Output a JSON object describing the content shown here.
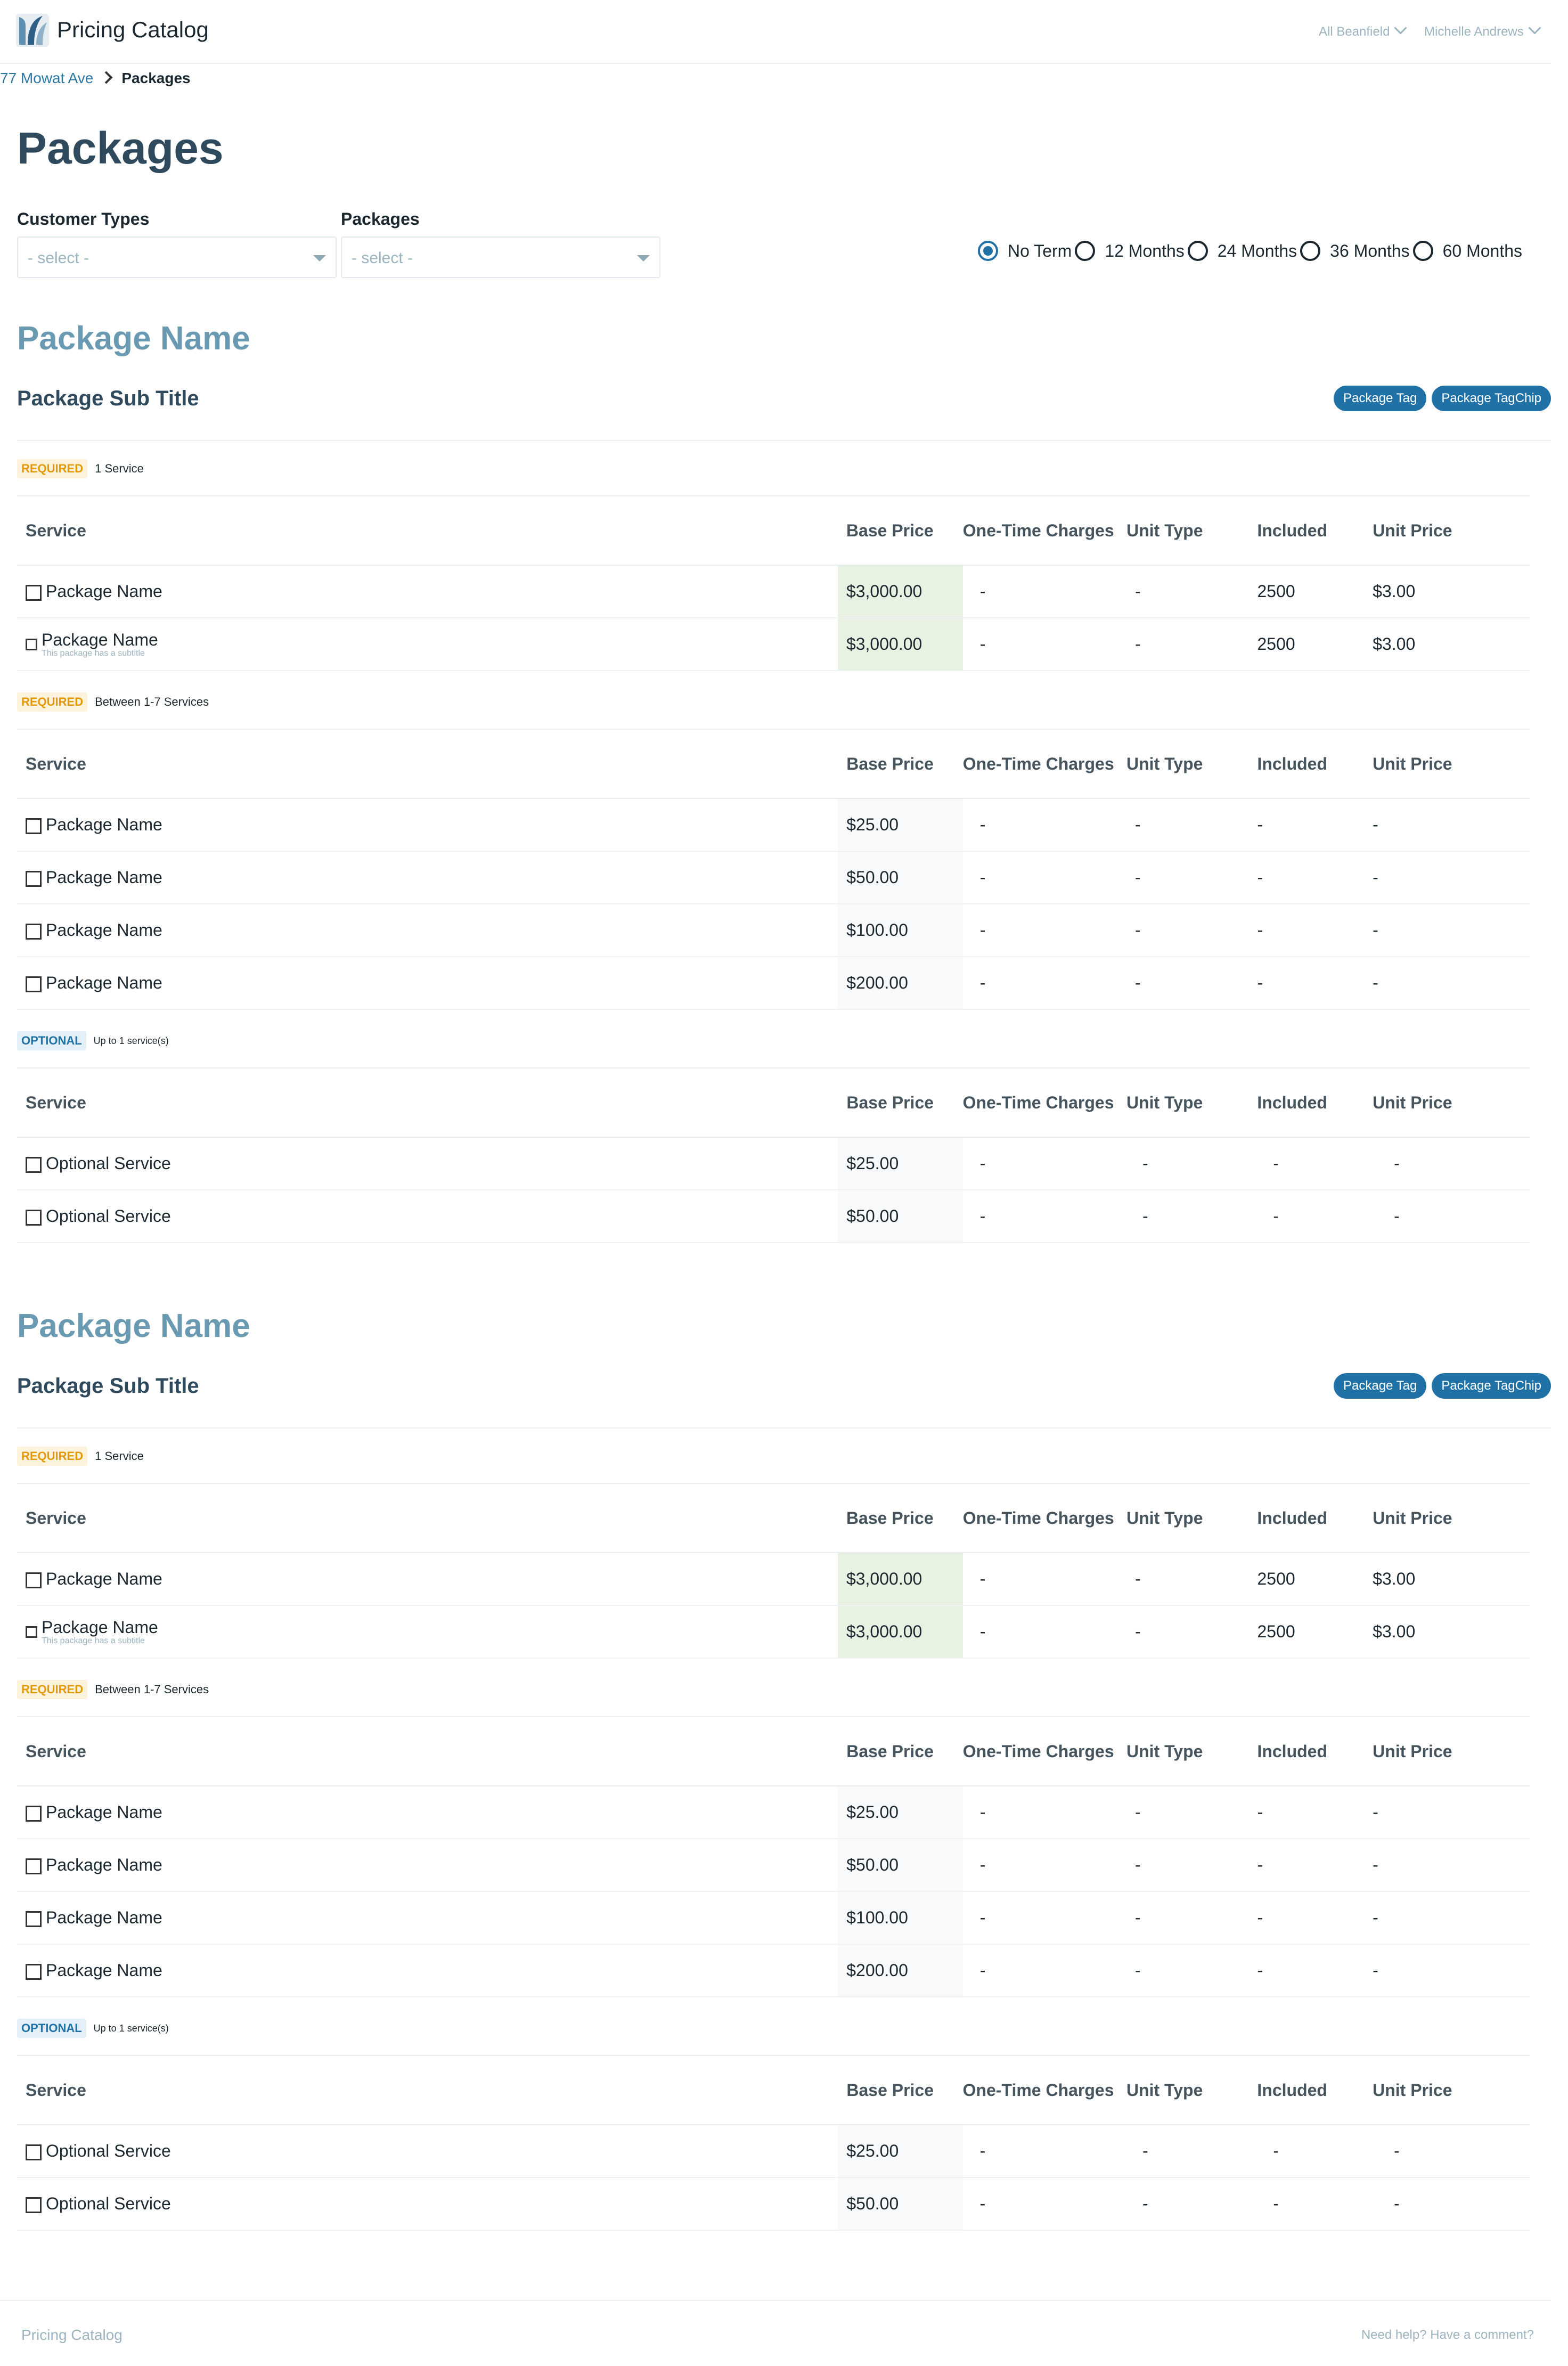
{
  "app": {
    "title": "Pricing Catalog"
  },
  "top_nav": {
    "location_selector": "All Beanfield",
    "user_menu": "Michelle Andrews"
  },
  "breadcrumb": {
    "parent": "77 Mowat Ave",
    "current": "Packages"
  },
  "page": {
    "title": "Packages"
  },
  "filters": {
    "customer_types": {
      "label": "Customer Types",
      "placeholder": "- select -"
    },
    "packages": {
      "label": "Packages",
      "placeholder": "- select -"
    }
  },
  "terms": {
    "options": [
      "No Term",
      "12 Months",
      "24 Months",
      "36 Months",
      "60 Months"
    ],
    "selected": "No Term"
  },
  "table_headers": [
    "Service",
    "Base Price",
    "One-Time Charges",
    "Unit Type",
    "Included",
    "Unit Price"
  ],
  "packages": [
    {
      "name": "Package Name",
      "subtitle": "Package Sub Title",
      "tags": [
        "Package Tag",
        "Package TagChip"
      ],
      "groups": [
        {
          "badge": "REQUIRED",
          "note": "1 Service",
          "rows": [
            {
              "service": "Package Name",
              "subtitle": "",
              "base_price": "$3,000.00",
              "one_time": "-",
              "unit_type": "-",
              "included": "2500",
              "unit_price": "$3.00"
            },
            {
              "service": "Package Name",
              "subtitle": "This package has a subtitle",
              "base_price": "$3,000.00",
              "one_time": "-",
              "unit_type": "-",
              "included": "2500",
              "unit_price": "$3.00"
            }
          ]
        },
        {
          "badge": "REQUIRED",
          "note": "Between 1-7 Services",
          "rows": [
            {
              "service": "Package Name",
              "base_price": "$25.00",
              "one_time": "-",
              "unit_type": "-",
              "included": "-",
              "unit_price": "-"
            },
            {
              "service": "Package Name",
              "base_price": "$50.00",
              "one_time": "-",
              "unit_type": "-",
              "included": "-",
              "unit_price": "-"
            },
            {
              "service": "Package Name",
              "base_price": "$100.00",
              "one_time": "-",
              "unit_type": "-",
              "included": "-",
              "unit_price": "-"
            },
            {
              "service": "Package Name",
              "base_price": "$200.00",
              "one_time": "-",
              "unit_type": "-",
              "included": "-",
              "unit_price": "-"
            }
          ]
        },
        {
          "badge": "OPTIONAL",
          "note": "Up to 1 service(s)",
          "rows": [
            {
              "service": "Optional Service",
              "base_price": "$25.00",
              "one_time": "-",
              "unit_type": "-",
              "included": "-",
              "unit_price": "-"
            },
            {
              "service": "Optional Service",
              "base_price": "$50.00",
              "one_time": "-",
              "unit_type": "-",
              "included": "-",
              "unit_price": "-"
            }
          ]
        }
      ]
    },
    {
      "name": "Package Name",
      "subtitle": "Package Sub Title",
      "tags": [
        "Package Tag",
        "Package TagChip"
      ],
      "groups": [
        {
          "badge": "REQUIRED",
          "note": "1 Service",
          "rows": [
            {
              "service": "Package Name",
              "subtitle": "",
              "base_price": "$3,000.00",
              "one_time": "-",
              "unit_type": "-",
              "included": "2500",
              "unit_price": "$3.00"
            },
            {
              "service": "Package Name",
              "subtitle": "This package has a subtitle",
              "base_price": "$3,000.00",
              "one_time": "-",
              "unit_type": "-",
              "included": "2500",
              "unit_price": "$3.00"
            }
          ]
        },
        {
          "badge": "REQUIRED",
          "note": "Between 1-7 Services",
          "rows": [
            {
              "service": "Package Name",
              "base_price": "$25.00",
              "one_time": "-",
              "unit_type": "-",
              "included": "-",
              "unit_price": "-"
            },
            {
              "service": "Package Name",
              "base_price": "$50.00",
              "one_time": "-",
              "unit_type": "-",
              "included": "-",
              "unit_price": "-"
            },
            {
              "service": "Package Name",
              "base_price": "$100.00",
              "one_time": "-",
              "unit_type": "-",
              "included": "-",
              "unit_price": "-"
            },
            {
              "service": "Package Name",
              "base_price": "$200.00",
              "one_time": "-",
              "unit_type": "-",
              "included": "-",
              "unit_price": "-"
            }
          ]
        },
        {
          "badge": "OPTIONAL",
          "note": "Up to 1 service(s)",
          "rows": [
            {
              "service": "Optional Service",
              "base_price": "$25.00",
              "one_time": "-",
              "unit_type": "-",
              "included": "-",
              "unit_price": "-"
            },
            {
              "service": "Optional Service",
              "base_price": "$50.00",
              "one_time": "-",
              "unit_type": "-",
              "included": "-",
              "unit_price": "-"
            }
          ]
        }
      ]
    }
  ],
  "footer": {
    "left": "Pricing Catalog",
    "right": "Need help? Have a comment?"
  },
  "colors": {
    "accent": "#2072a6",
    "package_title": "#6a9ab2",
    "required_badge": "#e39a06",
    "highlight_price": "#e8f2e3"
  }
}
